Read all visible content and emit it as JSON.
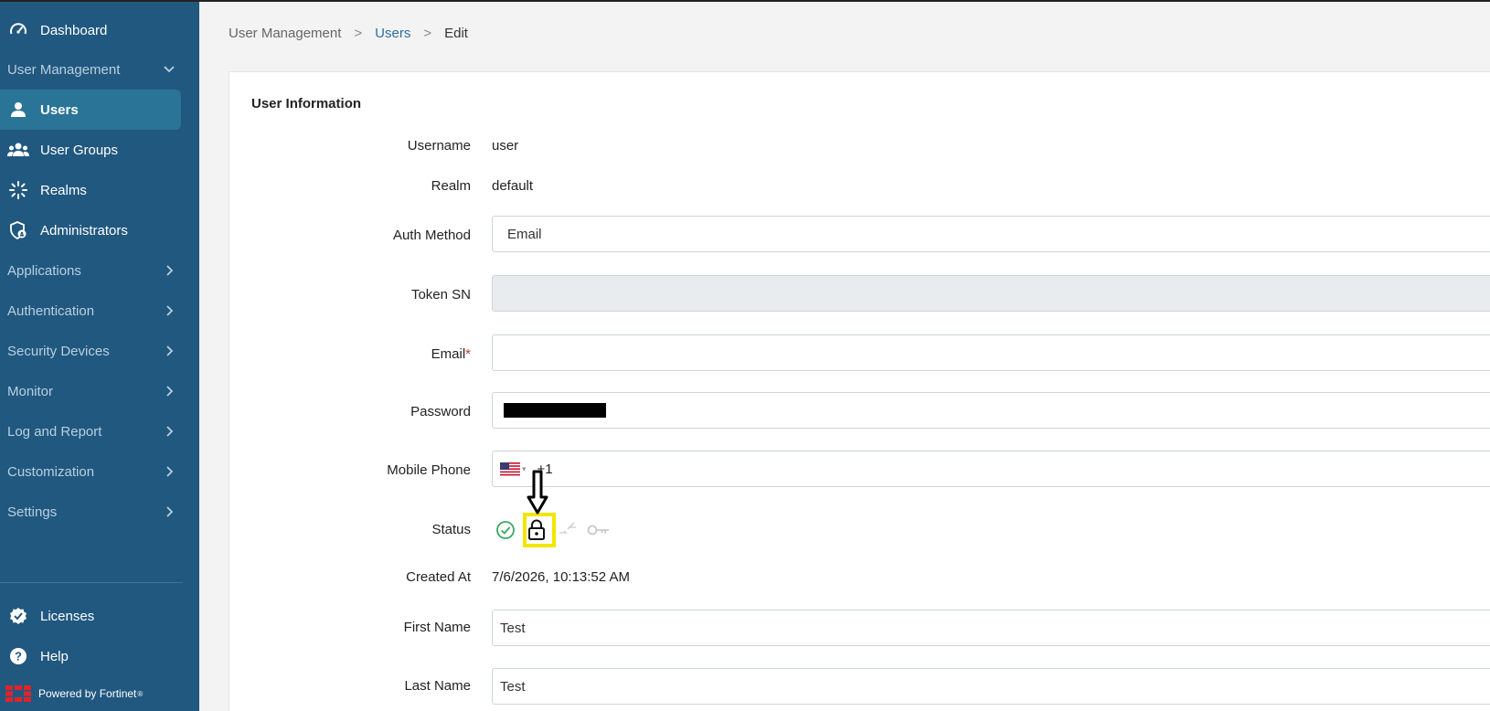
{
  "sidebar": {
    "dashboard": "Dashboard",
    "user_management": "User Management",
    "users": "Users",
    "user_groups": "User Groups",
    "realms": "Realms",
    "administrators": "Administrators",
    "applications": "Applications",
    "authentication": "Authentication",
    "security_devices": "Security Devices",
    "monitor": "Monitor",
    "log_and_report": "Log and Report",
    "customization": "Customization",
    "settings": "Settings",
    "licenses": "Licenses",
    "help": "Help",
    "powered_by": "Powered by Fortinet",
    "registered_mark": "®"
  },
  "breadcrumb": {
    "root": "User Management",
    "sep": ">",
    "users": "Users",
    "current": "Edit"
  },
  "form": {
    "section_title": "User Information",
    "username_label": "Username",
    "username_value": "user",
    "realm_label": "Realm",
    "realm_value": "default",
    "auth_method_label": "Auth Method",
    "auth_method_value": "Email",
    "token_sn_label": "Token SN",
    "token_sn_value": "",
    "email_label": "Email",
    "email_required": "*",
    "email_value": "",
    "password_label": "Password",
    "mobile_phone_label": "Mobile Phone",
    "phone_dial_code": "+1",
    "status_label": "Status",
    "created_at_label": "Created At",
    "created_at_value": "7/6/2026, 10:13:52 AM",
    "first_name_label": "First Name",
    "first_name_value": "Test",
    "last_name_label": "Last Name",
    "last_name_value": "Test"
  },
  "colors": {
    "sidebar_bg": "#21587f",
    "active_item_bg": "#2a7497",
    "link": "#2a6ea6",
    "highlight": "#f2e600",
    "status_ok": "#3aa864",
    "required": "#c0392b"
  },
  "icons": [
    "dashboard-gauge-icon",
    "user-icon",
    "users-group-icon",
    "realms-icon",
    "admin-shield-icon",
    "license-badge-icon",
    "help-icon",
    "fortinet-logo",
    "check-circle-icon",
    "lock-icon",
    "bypass-icon",
    "key-icon",
    "chevron-down-icon",
    "chevron-right-icon",
    "arrow-down-annotation"
  ]
}
